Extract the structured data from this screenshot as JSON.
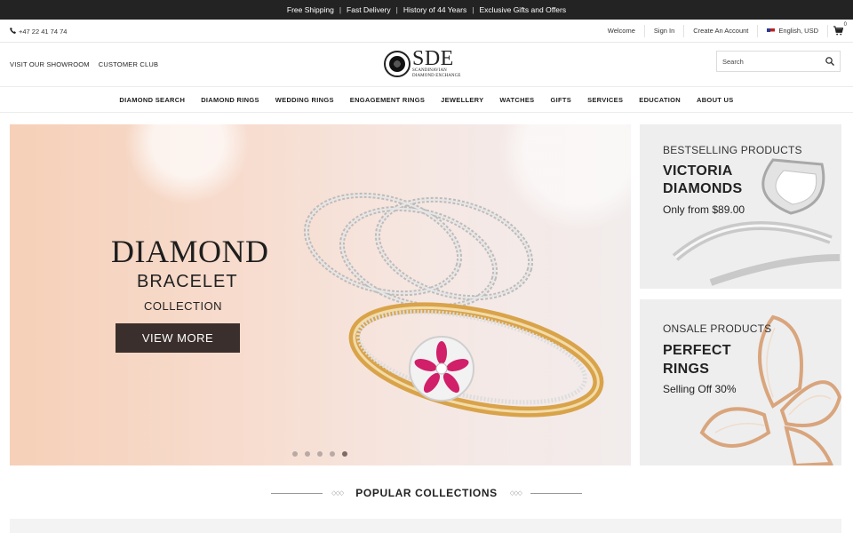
{
  "topbar": {
    "items": [
      "Free Shipping",
      "Fast Delivery",
      "History of 44 Years",
      "Exclusive Gifts and Offers"
    ]
  },
  "utility": {
    "phone": "+47 22 41 74 74",
    "welcome": "Welcome",
    "sign_in": "Sign In",
    "create_account": "Create An Account",
    "language": "English, USD",
    "cart_count": "0"
  },
  "header": {
    "showroom": "VISIT OUR SHOWROOM",
    "club": "CUSTOMER CLUB",
    "logo_main": "SDE",
    "logo_line1": "SCANDINAVIAN",
    "logo_line2": "DIAMOND EXCHANGE",
    "search_placeholder": "Search"
  },
  "nav": [
    "DIAMOND SEARCH",
    "DIAMOND RINGS",
    "WEDDING RINGS",
    "ENGAGEMENT RINGS",
    "JEWELLERY",
    "WATCHES",
    "GIFTS",
    "SERVICES",
    "EDUCATION",
    "ABOUT US"
  ],
  "hero": {
    "title": "DIAMOND",
    "subtitle": "BRACELET",
    "tagline": "COLLECTION",
    "button": "VIEW MORE",
    "slide_count": 5,
    "active_slide": 5
  },
  "promo1": {
    "label": "BESTSELLING PRODUCTS",
    "title_line1": "VICTORIA",
    "title_line2": "DIAMONDS",
    "sub": "Only from $89.00"
  },
  "promo2": {
    "label": "ONSALE PRODUCTS",
    "title_line1": "PERFECT",
    "title_line2": "RINGS",
    "sub": "Selling Off 30%"
  },
  "section": {
    "popular_title": "POPULAR COLLECTIONS"
  },
  "colors": {
    "topbar_bg": "#232323",
    "button_bg": "#3a2f2c",
    "accent_pink": "#d21f6a",
    "gold": "#d9a34a"
  }
}
